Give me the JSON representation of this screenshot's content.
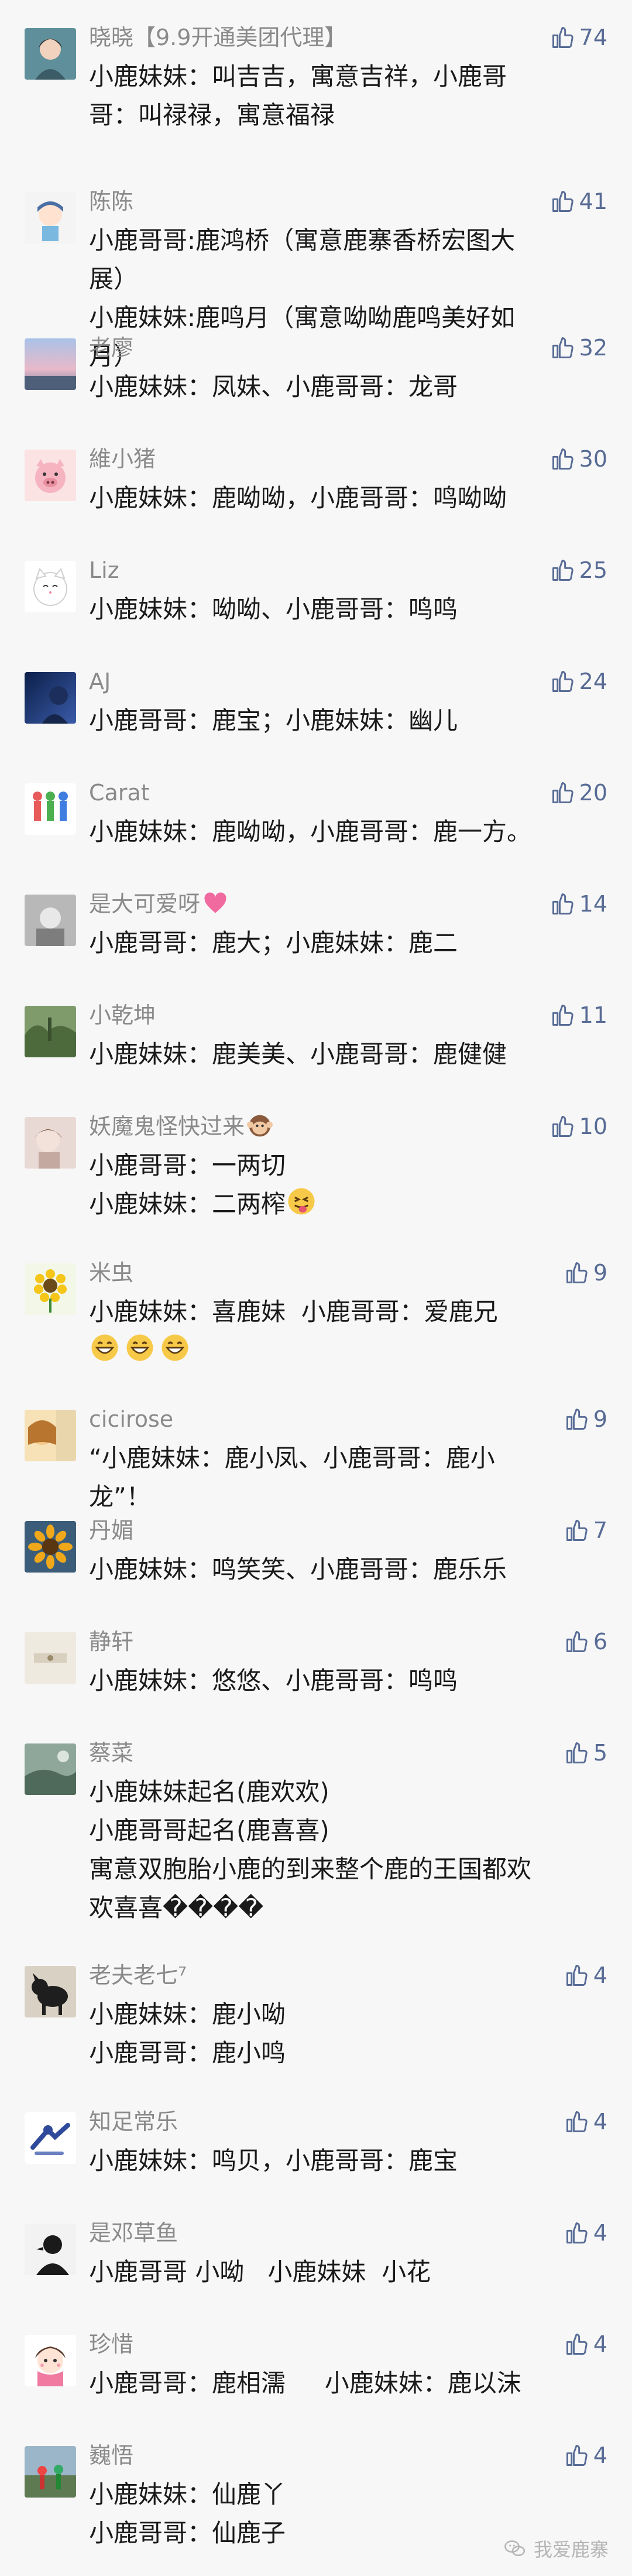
{
  "colors": {
    "background": "#f7f7f7",
    "nickname": "#8a8a8a",
    "text": "#1a1a1a",
    "like": "#576b95"
  },
  "comments": [
    {
      "nickname": "晓晓【9.9开通美团代理】",
      "likes": "74",
      "text": "小鹿妹妹：叫吉吉，寓意吉祥，小鹿哥哥：叫禄禄，寓意福禄"
    },
    {
      "nickname": "陈陈",
      "likes": "41",
      "text": "小鹿哥哥:鹿鸿桥（寓意鹿寨香桥宏图大展）\n小鹿妹妹:鹿鸣月（寓意呦呦鹿鸣美好如月）"
    },
    {
      "nickname": "老廖",
      "likes": "32",
      "text": "小鹿妹妹：凤妹、小鹿哥哥：龙哥"
    },
    {
      "nickname": "維小猪",
      "likes": "30",
      "text": "小鹿妹妹：鹿呦呦，小鹿哥哥：鸣呦呦"
    },
    {
      "nickname": "Liz",
      "likes": "25",
      "text": "小鹿妹妹：呦呦、小鹿哥哥：鸣鸣"
    },
    {
      "nickname": "AJ",
      "likes": "24",
      "text": "小鹿哥哥：鹿宝；小鹿妹妹：幽儿"
    },
    {
      "nickname": "Carat",
      "likes": "20",
      "text": "小鹿妹妹：鹿呦呦，小鹿哥哥：鹿一方。"
    },
    {
      "nickname": "是大可爱呀",
      "likes": "14",
      "text": "小鹿哥哥：鹿大；小鹿妹妹：鹿二"
    },
    {
      "nickname": "小乾坤",
      "likes": "11",
      "text": "小鹿妹妹：鹿美美、小鹿哥哥：鹿健健"
    },
    {
      "nickname": "妖魔鬼怪快过来",
      "likes": "10",
      "text": "小鹿哥哥：一两切\n小鹿妹妹：二两榨"
    },
    {
      "nickname": "米虫",
      "likes": "9",
      "text": "小鹿妹妹：喜鹿妹  小鹿哥哥：爱鹿兄"
    },
    {
      "nickname": "cicirose",
      "likes": "9",
      "text": "“小鹿妹妹：鹿小凤、小鹿哥哥：鹿小龙”！"
    },
    {
      "nickname": "丹媚",
      "likes": "7",
      "text": "小鹿妹妹：鸣笑笑、小鹿哥哥：鹿乐乐"
    },
    {
      "nickname": "静轩",
      "likes": "6",
      "text": "小鹿妹妹：悠悠、小鹿哥哥：鸣鸣"
    },
    {
      "nickname": "蔡菜",
      "likes": "5",
      "text": "小鹿妹妹起名(鹿欢欢)\n小鹿哥哥起名(鹿喜喜)\n寓意双胞胎小鹿的到来整个鹿的王国都欢欢喜喜����"
    },
    {
      "nickname": "老夫老七⁷",
      "likes": "4",
      "text": "小鹿妹妹：鹿小呦\n小鹿哥哥：鹿小鸣"
    },
    {
      "nickname": "知足常乐",
      "likes": "4",
      "text": "小鹿妹妹：鸣贝，小鹿哥哥：鹿宝"
    },
    {
      "nickname": "是邓草鱼",
      "likes": "4",
      "text": "小鹿哥哥 小呦   小鹿妹妹  小花"
    },
    {
      "nickname": "珍惜",
      "likes": "4",
      "text": "小鹿哥哥：鹿相濡     小鹿妹妹：鹿以沫"
    },
    {
      "nickname": "巍悟",
      "likes": "4",
      "text": "小鹿妹妹：仙鹿丫\n小鹿哥哥：仙鹿子"
    }
  ],
  "watermark": {
    "text": "我爱鹿寨",
    "icon": "wechat-icon"
  }
}
